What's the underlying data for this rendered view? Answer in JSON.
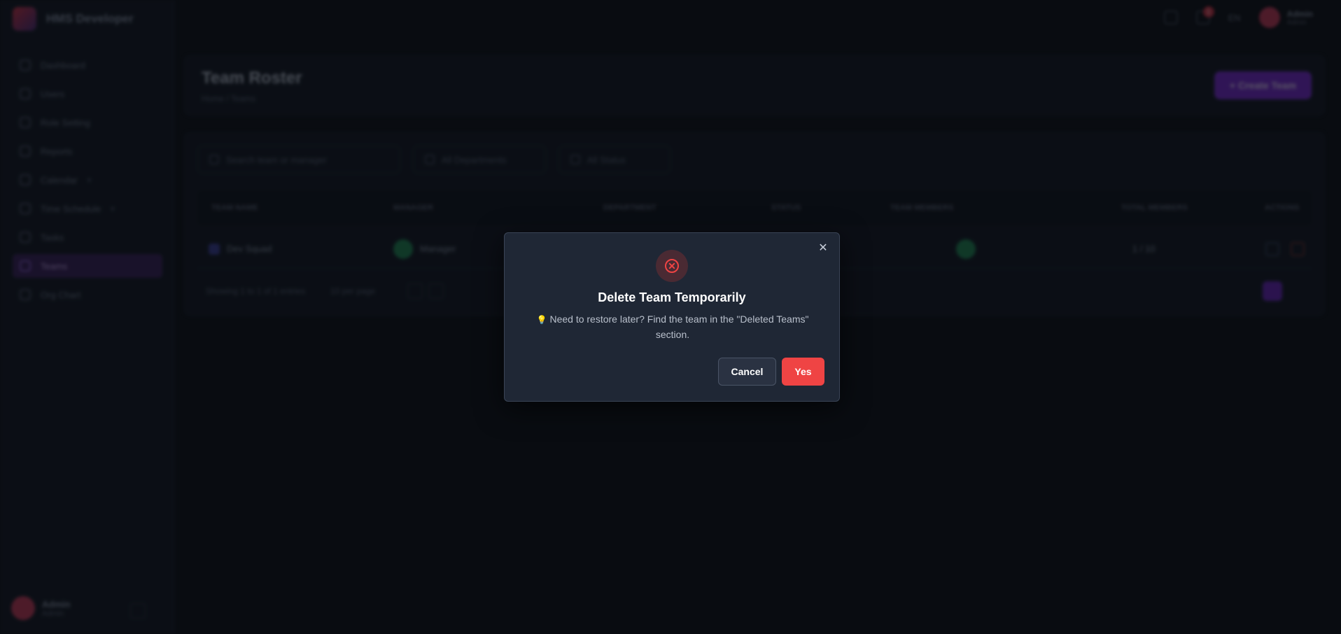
{
  "app": {
    "brand_name": "HMS Developer",
    "sidebar": {
      "items": [
        {
          "label": "Dashboard",
          "caret": ""
        },
        {
          "label": "Users",
          "caret": ""
        },
        {
          "label": "Role Setting",
          "caret": ""
        },
        {
          "label": "Reports",
          "caret": ""
        },
        {
          "label": "Calendar",
          "caret": "▾"
        },
        {
          "label": "Time Schedule",
          "caret": "▾"
        },
        {
          "label": "Tasks",
          "caret": ""
        },
        {
          "label": "Teams",
          "caret": ""
        },
        {
          "label": "Org Chart",
          "caret": ""
        }
      ],
      "active_index": 7,
      "user_name": "Admin",
      "user_role": "Admin"
    },
    "topbar": {
      "notification_count": "1",
      "language": "EN",
      "user_name": "Admin",
      "user_role": "Admin"
    },
    "page": {
      "title": "Team Roster",
      "breadcrumb": "Home / Teams",
      "primary_button": "+ Create Team"
    },
    "filters": {
      "search_placeholder": "Search team or manager",
      "department": "All Departments",
      "status": "All Status"
    },
    "table": {
      "headers": [
        "TEAM NAME",
        "MANAGER",
        "DEPARTMENT",
        "STATUS",
        "TEAM MEMBERS",
        "TOTAL MEMBERS",
        "ACTIONS"
      ],
      "row": {
        "team_name": "Dev Squad",
        "manager": "Manager",
        "members_count": "1 / 10"
      }
    },
    "pager": {
      "summary": "Showing 1 to 1 of 1 entries",
      "per_page": "10 per page"
    }
  },
  "modal": {
    "title": "Delete Team Temporarily",
    "bulb_icon": "💡",
    "body": "Need to restore later? Find the team in the \"Deleted Teams\" section.",
    "cancel_label": "Cancel",
    "confirm_label": "Yes",
    "close_glyph": "✕",
    "colors": {
      "confirm": "#ef4444",
      "icon_ring": "#ef4444",
      "surface": "#1f2735"
    }
  }
}
